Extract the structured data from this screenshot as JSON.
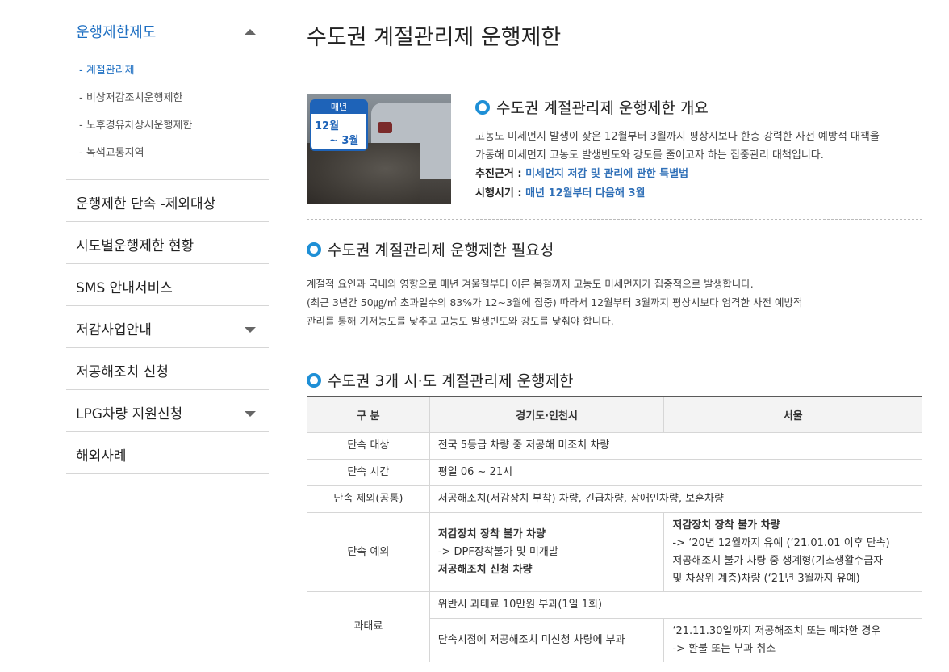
{
  "sidebar": {
    "header": "운행제한제도",
    "sub_items": [
      "- 계절관리제",
      "- 비상저감조치운행제한",
      "- 노후경유차상시운행제한",
      "- 녹색교통지역"
    ],
    "menu": [
      "운행제한 단속 -제외대상",
      "시도별운행제한 현황",
      "SMS 안내서비스",
      "저감사업안내",
      "저공해조치 신청",
      "LPG차량 지원신청",
      "해외사례"
    ]
  },
  "page_title": "수도권 계절관리제 운행제한",
  "thumbnail": {
    "cal_top": "매년",
    "cal_a": "12월",
    "cal_b": "~ 3월"
  },
  "overview": {
    "heading": "수도권 계절관리제 운행제한 개요",
    "line1": "고농도 미세먼지 발생이 잦은 12월부터 3월까지 평상시보다 한층 강력한 사전 예방적 대책을",
    "line2": "가동해 미세먼지 고농도 발생빈도와 강도를 줄이고자 하는 집중관리 대책입니다.",
    "basis_label": "추진근거 : ",
    "basis_value": "미세먼지 저감 및 관리에 관한 특별법",
    "period_label": "시행시기 : ",
    "period_value": "매년 12월부터 다음해 3월"
  },
  "need": {
    "heading": "수도권 계절관리제 운행제한 필요성",
    "line1": "계절적 요인과 국내외 영향으로 매년 겨울철부터 이른 봄철까지 고농도 미세먼지가 집중적으로 발생합니다.",
    "line2": "(최근 3년간 50㎍/㎥ 초과일수의 83%가 12~3월에 집중) 따라서 12월부터 3월까지 평상시보다 엄격한 사전 예방적",
    "line3": "관리를 통해 기저농도를 낮추고 고농도 발생빈도와 강도를 낮춰야 합니다."
  },
  "cities": {
    "heading": "수도권 3개 시·도 계절관리제 운행제한",
    "headers": [
      "구 분",
      "경기도·인천시",
      "서울"
    ],
    "target_label": "단속 대상",
    "target_value": "전국 5등급 차량 중 저공해 미조치 차량",
    "time_label": "단속 시간",
    "time_value": "평일 06 ~ 21시",
    "excl_label": "단속 제외(공통)",
    "excl_value": "저공해조치(저감장치 부착) 차량, 긴급차량, 장애인차량, 보훈차량",
    "except_label": "단속 예외",
    "gg_l1": "저감장치 장착 불가 차량",
    "gg_l2": "-> DPF장착불가 및 미개발",
    "gg_l3": "저공해조치 신청 차량",
    "se_l1": "저감장치 장착 불가 차량",
    "se_l2": "-> ‘20년 12월까지 유예 (‘21.01.01 이후 단속)",
    "se_l3": "저공해조치 불가 차량 중 생계형(기초생활수급자",
    "se_l4": "및 차상위 계층)차량 (‘21년 3월까지 유예)",
    "fine_label": "과태료",
    "fine_value": "위반시 과태료 10만원 부과(1일 1회)",
    "fine_gg": "단속시점에 저공해조치 미신청 차량에 부과",
    "fine_se_l1": "‘21.11.30일까지 저공해조치 또는 폐차한 경우",
    "fine_se_l2": "-> 환불 또는 부과 취소"
  }
}
